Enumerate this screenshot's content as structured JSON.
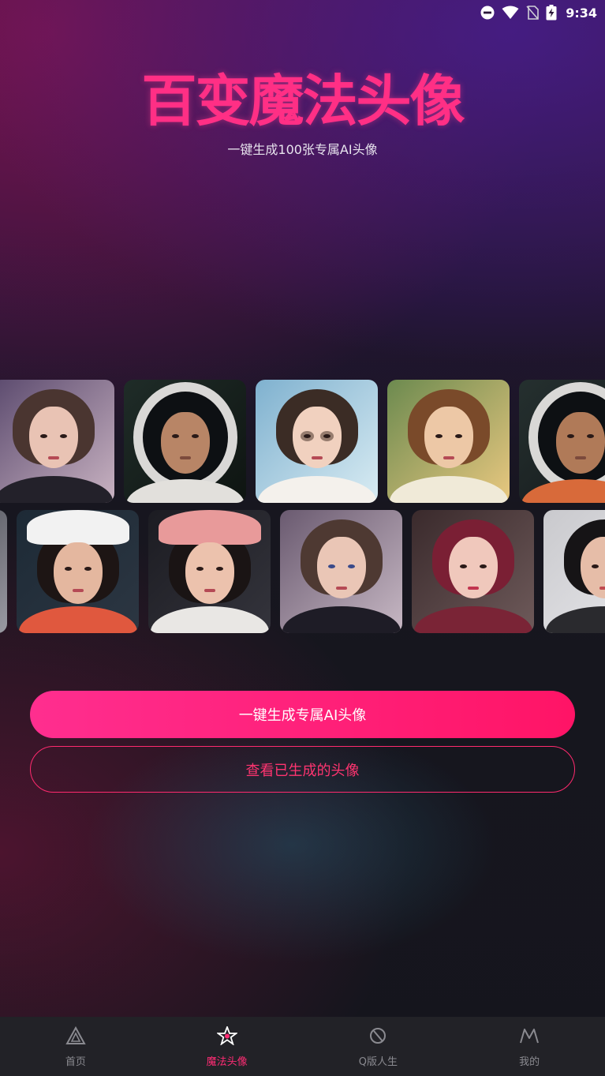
{
  "status_bar": {
    "time": "9:34",
    "icons": [
      "do-not-disturb-icon",
      "wifi-icon",
      "no-sim-icon",
      "battery-charging-icon"
    ]
  },
  "hero": {
    "title": "百变魔法头像",
    "subtitle": "一键生成100张专属AI头像"
  },
  "gallery": {
    "row1": [
      "girl-purple-bob",
      "astronaut-man",
      "man-glasses",
      "boy-brown-hair",
      "astronaut-man-2"
    ],
    "row2": [
      "partial-edge",
      "girl-white-cap",
      "girl-pink-cap",
      "girl-brown-bob",
      "woman-red-hair",
      "woman-black-curls"
    ]
  },
  "actions": {
    "primary_label": "一键生成专属AI头像",
    "secondary_label": "查看已生成的头像"
  },
  "nav": {
    "items": [
      {
        "label": "首页",
        "icon": "home-triangle-icon",
        "active": false
      },
      {
        "label": "魔法头像",
        "icon": "magic-star-icon",
        "active": true
      },
      {
        "label": "Q版人生",
        "icon": "q-life-icon",
        "active": false
      },
      {
        "label": "我的",
        "icon": "profile-m-icon",
        "active": false
      }
    ]
  },
  "colors": {
    "accent": "#ff2c74",
    "primary_gradient_start": "#ff2e8f",
    "primary_gradient_end": "#ff1466",
    "nav_background": "#222227",
    "nav_inactive": "#8a8a90"
  }
}
